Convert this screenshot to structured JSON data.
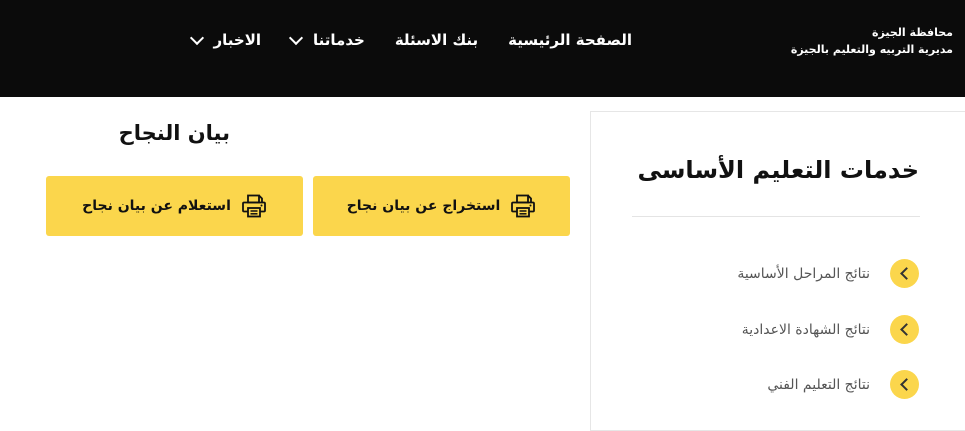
{
  "header": {
    "brand_line1": "محافظة الجيزة",
    "brand_line2": "مديرية التربيه والتعليم بالجيزة",
    "nav": [
      {
        "label": "الصفحة الرئيسية",
        "has_dropdown": false
      },
      {
        "label": "بنك الاسئلة",
        "has_dropdown": false
      },
      {
        "label": "خدماتنا",
        "has_dropdown": true
      },
      {
        "label": "الاخبار",
        "has_dropdown": true
      }
    ]
  },
  "sidebar": {
    "title": "خدمات التعليم الأساسى",
    "links": [
      {
        "label": "نتائج المراحل الأساسية"
      },
      {
        "label": "نتائج الشهادة الاعدادية"
      },
      {
        "label": "نتائج التعليم الفني"
      }
    ]
  },
  "main": {
    "title": "بيان النجاح",
    "buttons": [
      {
        "label": "استخراج عن بيان نجاح",
        "icon": "printer-icon"
      },
      {
        "label": "استعلام عن بيان نجاح",
        "icon": "printer-icon"
      }
    ]
  },
  "colors": {
    "header_bg": "#0b0b0b",
    "accent": "#fbd64c"
  }
}
